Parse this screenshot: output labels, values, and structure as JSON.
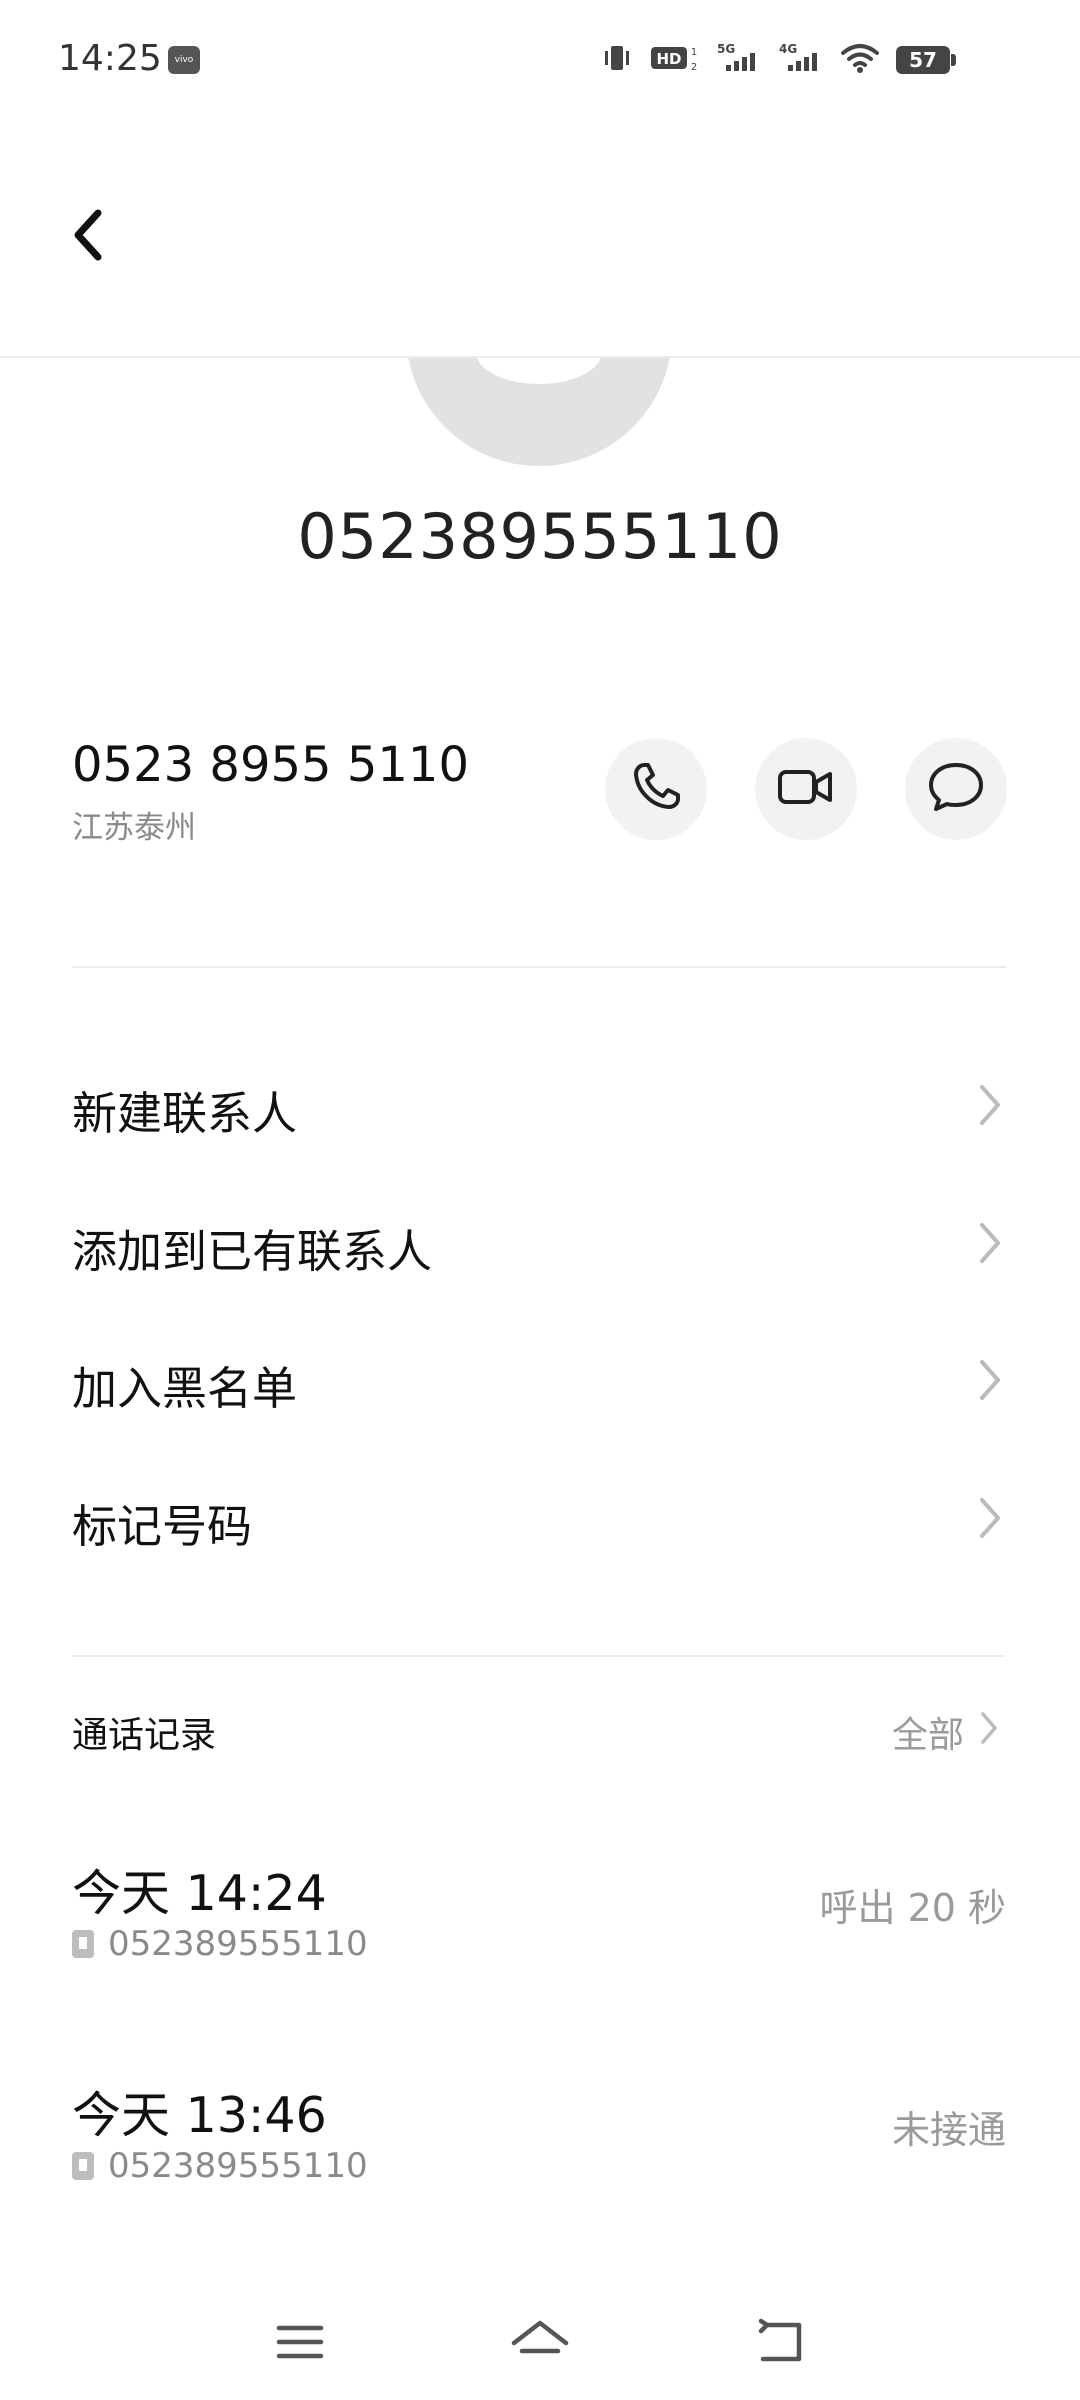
{
  "status_bar": {
    "time": "14:25",
    "carrier_badge": "vivo",
    "battery": "57",
    "icons": [
      "vibrate-icon",
      "hd-icon",
      "signal-5g-icon",
      "signal-4g-icon",
      "wifi-icon",
      "battery-icon"
    ]
  },
  "header": {
    "back_icon": "back-arrow-icon"
  },
  "contact": {
    "title_number": "052389555110",
    "formatted_number": "0523 8955 5110",
    "location": "江苏泰州"
  },
  "actions": [
    {
      "name": "call",
      "icon": "phone-icon"
    },
    {
      "name": "video",
      "icon": "video-camera-icon"
    },
    {
      "name": "message",
      "icon": "message-bubble-icon"
    }
  ],
  "menu": {
    "items": [
      {
        "label": "新建联系人"
      },
      {
        "label": "添加到已有联系人"
      },
      {
        "label": "加入黑名单"
      },
      {
        "label": "标记号码"
      }
    ]
  },
  "call_records": {
    "title": "通话记录",
    "all_label": "全部",
    "records": [
      {
        "time": "今天 14:24",
        "number": "052389555110",
        "status": "呼出 20 秒"
      },
      {
        "time": "今天 13:46",
        "number": "052389555110",
        "status": "未接通"
      }
    ]
  },
  "nav_bar": {
    "icons": [
      "menu-icon",
      "home-icon",
      "back-icon"
    ]
  },
  "colors": {
    "background": "#ffffff",
    "primary_text": "#111111",
    "secondary_text": "#8a8a8a",
    "button_bg": "#f2f2f2",
    "divider": "#ececec"
  }
}
